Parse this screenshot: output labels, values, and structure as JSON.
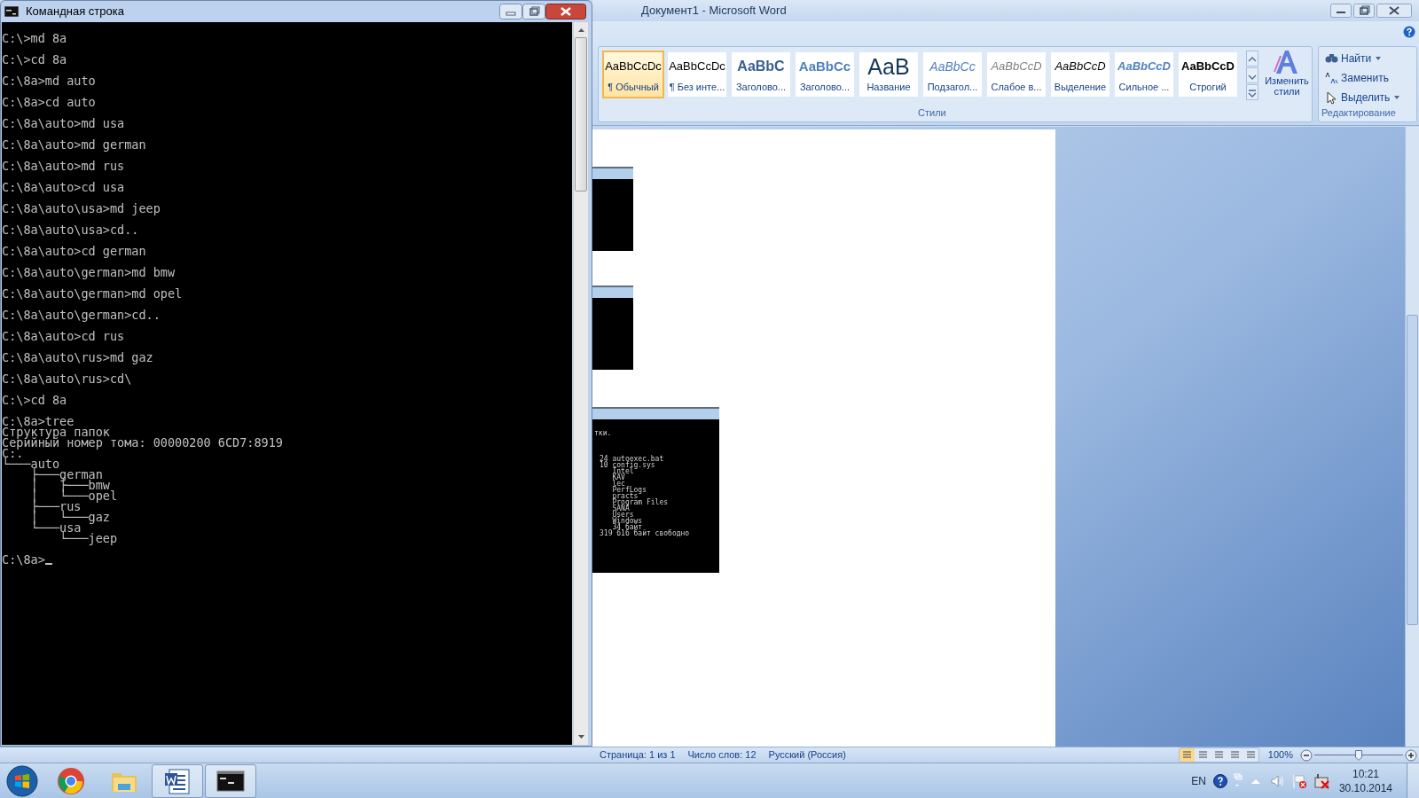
{
  "console_window": {
    "title": "Командная строка",
    "blocks": [
      [
        "C:\\>md 8a"
      ],
      [
        "C:\\>cd 8a"
      ],
      [
        "C:\\8a>md auto"
      ],
      [
        "C:\\8a>cd auto"
      ],
      [
        "C:\\8a\\auto>md usa"
      ],
      [
        "C:\\8a\\auto>md german"
      ],
      [
        "C:\\8a\\auto>md rus"
      ],
      [
        "C:\\8a\\auto>cd usa"
      ],
      [
        "C:\\8a\\auto\\usa>md jeep"
      ],
      [
        "C:\\8a\\auto\\usa>cd.."
      ],
      [
        "C:\\8a\\auto>cd german"
      ],
      [
        "C:\\8a\\auto\\german>md bmw"
      ],
      [
        "C:\\8a\\auto\\german>md opel"
      ],
      [
        "C:\\8a\\auto\\german>cd.."
      ],
      [
        "C:\\8a\\auto>cd rus"
      ],
      [
        "C:\\8a\\auto\\rus>md gaz"
      ],
      [
        "C:\\8a\\auto\\rus>cd\\"
      ],
      [
        "C:\\>cd 8a"
      ],
      [
        "C:\\8a>tree",
        "Структура папок",
        "Серийный номер тома: 00000200 6CD7:8919",
        "C:.",
        "└───auto",
        "    ├───german",
        "    │   ├───bmw",
        "    │   └───opel",
        "    ├───rus",
        "    │   └───gaz",
        "    └───usa",
        "        └───jeep"
      ]
    ],
    "prompt": "C:\\8a>"
  },
  "word_window": {
    "title": "Документ1 - Microsoft Word",
    "styles": [
      {
        "preview": "AaBbCcDc",
        "label": "¶ Обычный",
        "kind": "normal",
        "selected": true
      },
      {
        "preview": "AaBbCcDc",
        "label": "¶ Без инте...",
        "kind": "normal",
        "selected": false
      },
      {
        "preview": "AaBbC",
        "label": "Заголово...",
        "kind": "heading1",
        "selected": false
      },
      {
        "preview": "AaBbCc",
        "label": "Заголово...",
        "kind": "heading2",
        "selected": false
      },
      {
        "preview": "AaB",
        "label": "Название",
        "kind": "title",
        "selected": false
      },
      {
        "preview": "AaBbCc",
        "label": "Подзагол...",
        "kind": "subtitle",
        "selected": false
      },
      {
        "preview": "AaBbCcD",
        "label": "Слабое в...",
        "kind": "subtle",
        "selected": false
      },
      {
        "preview": "AaBbCcD",
        "label": "Выделение",
        "kind": "emphasis",
        "selected": false
      },
      {
        "preview": "AaBbCcD",
        "label": "Сильное ...",
        "kind": "intense",
        "selected": false
      },
      {
        "preview": "AaBbCcD",
        "label": "Строгий",
        "kind": "strong",
        "selected": false
      }
    ],
    "change_styles_label": "Изменить стили",
    "styles_group_label": "Стили",
    "editing": [
      {
        "label": "Найти",
        "kind": "find"
      },
      {
        "label": "Заменить",
        "kind": "replace"
      },
      {
        "label": "Выделить",
        "kind": "select"
      }
    ],
    "editing_group_label": "Редактирование",
    "embedded_screenshots": [
      {
        "kind": "small"
      },
      {
        "kind": "small"
      },
      {
        "kind": "large",
        "header": "тки.",
        "lines": [
          "24 autoexec.bat",
          "10 config.sys",
          "   Intel",
          "   KAV",
          "   lec",
          "   PerfLogs",
          "   practs",
          "   Program Files",
          "   SANA",
          "   Users",
          "   Windows",
          "   34 байт",
          "319 616 байт свободно"
        ]
      }
    ],
    "status_bar": {
      "items": [
        "Страница: 1 из 1",
        "Число слов: 12",
        "Русский (Россия)"
      ],
      "zoom": "100%",
      "zoom_slider": {
        "level": 0.5
      }
    }
  },
  "taskbar": {
    "apps": [
      {
        "kind": "start",
        "open": false
      },
      {
        "kind": "browser",
        "open": false
      },
      {
        "kind": "folder",
        "open": false
      },
      {
        "kind": "word",
        "open": true
      },
      {
        "kind": "console",
        "open": true
      }
    ],
    "language": "EN",
    "time": "10:21",
    "date": "30.10.2014"
  }
}
